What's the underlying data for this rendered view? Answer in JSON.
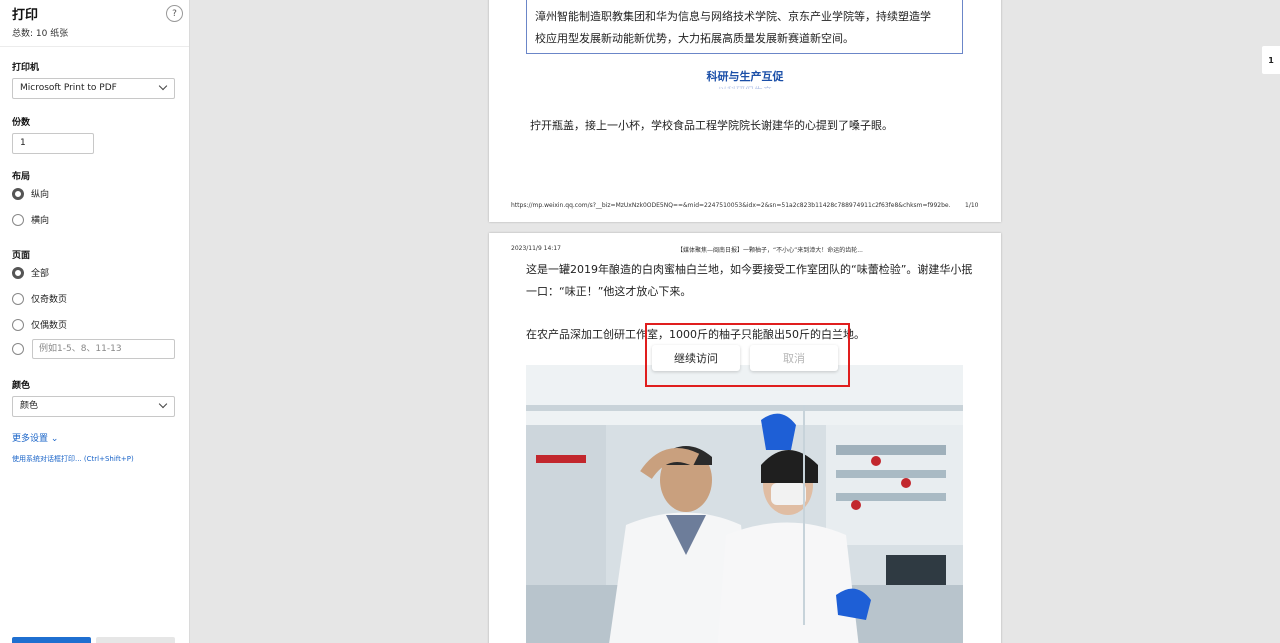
{
  "sidebar": {
    "title": "打印",
    "total": "总数: 10 纸张",
    "help": "?",
    "printer_label": "打印机",
    "printer_value": "Microsoft Print to PDF",
    "copies_label": "份数",
    "copies_value": "1",
    "layout_label": "布局",
    "layout_options": [
      "纵向",
      "横向"
    ],
    "pages_label": "页面",
    "pages_options": [
      "全部",
      "仅奇数页",
      "仅偶数页"
    ],
    "pages_range_placeholder": "例如1-5、8、11-13",
    "color_label": "颜色",
    "color_value": "颜色",
    "more_settings": "更多设置 ⌄",
    "system_dialog": "使用系统对话框打印... (Ctrl+Shift+P)"
  },
  "page1": {
    "box_lines": [
      "漳州智能制造职教集团和华为信息与网络技术学院、京东产业学院等，持续塑造学",
      "校应用型发展新动能新优势，大力拓展高质量发展新赛道新空间。"
    ],
    "section_title": "科研与生产互促",
    "section_subtitle": "以科研促生产",
    "paragraph": "拧开瓶盖，接上一小杯，学校食品工程学院院长谢建华的心提到了嗓子眼。",
    "footer_url": "https://mp.weixin.qq.com/s?__biz=MzUxNzk0ODE5NQ==&mid=2247510053&idx=2&sn=51a2c823b11428c788974911c2f63fe8&chksm=f992be...",
    "footer_page": "1/10"
  },
  "page2": {
    "header_date": "2023/11/9 14:17",
    "header_title": "【媒体聚焦—闽南日报】一颗柚子，“不小心”来到漳大！命运的齿轮...",
    "line1": "这是一罐2019年酿造的白肉蜜柚白兰地，如今要接受工作室团队的“味蕾检验”。谢建华小抿",
    "line2": "一口：“味正！”他这才放心下来。",
    "line3": "在农产品深加工创研工作室，1000斤的柚子只能酿出50斤的白兰地。"
  },
  "dialog": {
    "continue": "继续访问",
    "cancel": "取消"
  },
  "right_panel": {
    "page_number": "1"
  }
}
